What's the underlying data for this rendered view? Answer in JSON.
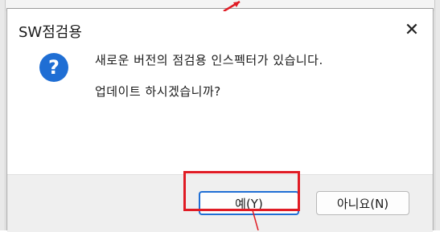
{
  "dialog": {
    "title": "SW점검용",
    "close_symbol": "✕",
    "icon": "question-icon",
    "icon_glyph": "?",
    "message_line1": "새로운 버전의 점검용 인스펙터가 있습니다.",
    "message_line2": "업데이트 하시겠습니까?",
    "buttons": {
      "yes_label": "예(Y)",
      "no_label": "아니요(N)"
    }
  },
  "colors": {
    "accent": "#1f6ed4",
    "highlight": "#e01b24"
  }
}
